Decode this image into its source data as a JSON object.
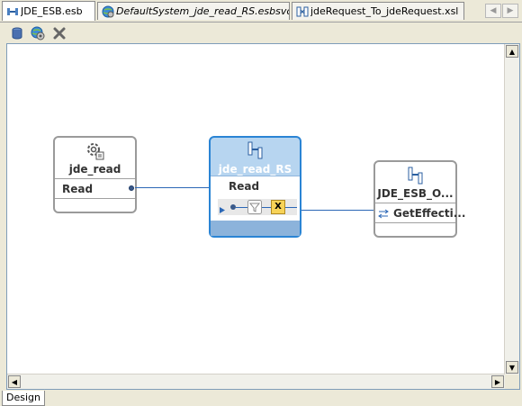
{
  "tabs": [
    {
      "label": "JDE_ESB.esb",
      "icon": "esb-diagram-icon",
      "active": true
    },
    {
      "label": "DefaultSystem_jde_read_RS.esbsvc",
      "icon": "globe-service-icon",
      "active": false
    },
    {
      "label": "jdeRequest_To_jdeRequest.xsl",
      "icon": "xsl-map-icon",
      "active": false
    }
  ],
  "toolbar": {
    "buttons": [
      "database-icon",
      "globe-gear-icon",
      "delete-x-icon"
    ]
  },
  "nodes": {
    "adapter": {
      "title": "jde_read",
      "operation": "Read",
      "icon": "gear-adapter-icon"
    },
    "router": {
      "title": "jde_read_RS",
      "operation": "Read",
      "icon": "routing-service-icon",
      "filter_icon": "filter-icon",
      "transform_icon": "xsl-transform-icon",
      "transform_glyph": "X"
    },
    "target": {
      "title": "JDE_ESB_O...",
      "operation": "GetEffecti...",
      "icon": "routing-service-icon"
    }
  },
  "bottom_tabs": [
    {
      "label": "Design",
      "active": true
    }
  ],
  "colors": {
    "selection_border": "#2a84d4",
    "selection_fill": "#b7d5f0",
    "wire": "#2b67b6",
    "node_border": "#9a9a9a"
  }
}
